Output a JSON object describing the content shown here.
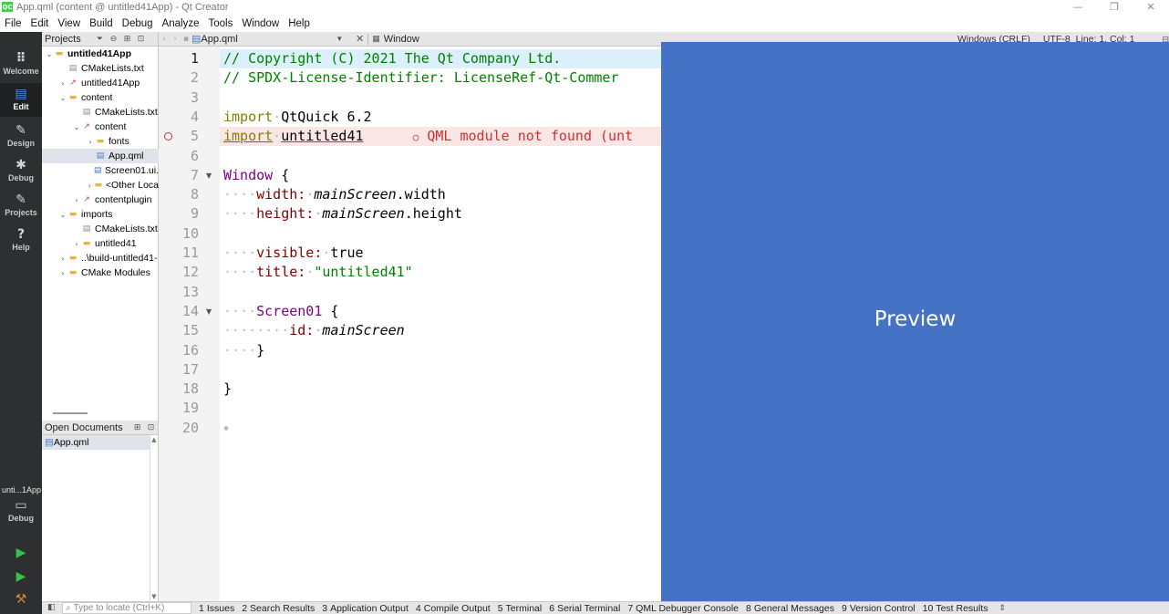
{
  "window": {
    "app_icon": "QC",
    "title": "App.qml (content @ untitled41App) - Qt Creator",
    "controls": [
      "—",
      "❐",
      "✕"
    ]
  },
  "menu": [
    "File",
    "Edit",
    "View",
    "Build",
    "Debug",
    "Analyze",
    "Tools",
    "Window",
    "Help"
  ],
  "modes": [
    {
      "label": "Welcome",
      "icon": "grid-icon",
      "glyph": "⠿"
    },
    {
      "label": "Edit",
      "icon": "edit-icon",
      "glyph": "▤",
      "active": true
    },
    {
      "label": "Design",
      "icon": "pen-icon",
      "glyph": "✎"
    },
    {
      "label": "Debug",
      "icon": "bug-icon",
      "glyph": "✱"
    },
    {
      "label": "Projects",
      "icon": "wrench-icon",
      "glyph": "✎"
    },
    {
      "label": "Help",
      "icon": "help-icon",
      "glyph": "?"
    }
  ],
  "kit": {
    "label": "unti...1App",
    "mode": "Debug",
    "glyph": "▭"
  },
  "projects": {
    "title": "Projects",
    "tree": [
      {
        "label": "untitled41App",
        "depth": 0,
        "arrow": "v",
        "icon": "folder",
        "bold": true
      },
      {
        "label": "CMakeLists.txt",
        "depth": 1,
        "arrow": "",
        "icon": "cmake"
      },
      {
        "label": "untitled41App",
        "depth": 1,
        "arrow": ">",
        "icon": "proj"
      },
      {
        "label": "content",
        "depth": 1,
        "arrow": "v",
        "icon": "folder"
      },
      {
        "label": "CMakeLists.txt",
        "depth": 2,
        "arrow": "",
        "icon": "cmake"
      },
      {
        "label": "content",
        "depth": 2,
        "arrow": "v",
        "icon": "proj"
      },
      {
        "label": "fonts",
        "depth": 3,
        "arrow": ">",
        "icon": "folder"
      },
      {
        "label": "App.qml",
        "depth": 3,
        "arrow": "",
        "icon": "qml",
        "selected": true
      },
      {
        "label": "Screen01.ui.",
        "depth": 3,
        "arrow": "",
        "icon": "qml"
      },
      {
        "label": "<Other Loca",
        "depth": 3,
        "arrow": ">",
        "icon": "folder"
      },
      {
        "label": "contentplugin",
        "depth": 2,
        "arrow": ">",
        "icon": "proj"
      },
      {
        "label": "imports",
        "depth": 1,
        "arrow": "v",
        "icon": "folder"
      },
      {
        "label": "CMakeLists.txt",
        "depth": 2,
        "arrow": "",
        "icon": "cmake"
      },
      {
        "label": "untitled41",
        "depth": 2,
        "arrow": ">",
        "icon": "folder"
      },
      {
        "label": "..\\build-untitled41-",
        "depth": 1,
        "arrow": ">",
        "icon": "folder"
      },
      {
        "label": "CMake Modules",
        "depth": 1,
        "arrow": ">",
        "icon": "folder"
      }
    ]
  },
  "open_documents": {
    "title": "Open Documents",
    "items": [
      "App.qml"
    ]
  },
  "editor_toolbar": {
    "file": "App.qml",
    "symbol": "Window",
    "line_endings": "Windows (CRLF)",
    "encoding": "UTF-8",
    "position": "Line: 1, Col: 1"
  },
  "editor": {
    "lines": [
      {
        "n": "1"
      },
      {
        "n": "2"
      },
      {
        "n": "3"
      },
      {
        "n": "4"
      },
      {
        "n": "5"
      },
      {
        "n": "6"
      },
      {
        "n": "7"
      },
      {
        "n": "8"
      },
      {
        "n": "9"
      },
      {
        "n": "10"
      },
      {
        "n": "11"
      },
      {
        "n": "12"
      },
      {
        "n": "13"
      },
      {
        "n": "14"
      },
      {
        "n": "15"
      },
      {
        "n": "16"
      },
      {
        "n": "17"
      },
      {
        "n": "18"
      },
      {
        "n": "19"
      },
      {
        "n": "20"
      }
    ],
    "code": {
      "l1": "// Copyright (C) 2021 The Qt Company Ltd.",
      "l2": "// SPDX-License-Identifier: LicenseRef-Qt-Commer",
      "l4_kw": "import",
      "l4_rest": "QtQuick 6.2",
      "l5_kw": "import",
      "l5_mod": "untitled41",
      "l5_err": "QML module not found (unt",
      "l7_type": "Window",
      "l7_rest": " {",
      "l8_prop": "width:",
      "l8_val": "mainScreen",
      "l8_rest": ".width",
      "l9_prop": "height:",
      "l9_val": "mainScreen",
      "l9_rest": ".height",
      "l11_prop": "visible:",
      "l11_val": "true",
      "l12_prop": "title:",
      "l12_val": "\"untitled41\"",
      "l14_type": "Screen01",
      "l14_rest": " {",
      "l15_prop": "id:",
      "l15_val": "mainScreen",
      "l16": "}",
      "l18": "}"
    }
  },
  "preview": {
    "label": "Preview"
  },
  "statusbar": {
    "locator_placeholder": "Type to locate (Ctrl+K)",
    "tabs": [
      {
        "num": "1",
        "label": "Issues"
      },
      {
        "num": "2",
        "label": "Search Results"
      },
      {
        "num": "3",
        "label": "Application Output"
      },
      {
        "num": "4",
        "label": "Compile Output"
      },
      {
        "num": "5",
        "label": "Terminal"
      },
      {
        "num": "6",
        "label": "Serial Terminal"
      },
      {
        "num": "7",
        "label": "QML Debugger Console"
      },
      {
        "num": "8",
        "label": "General Messages"
      },
      {
        "num": "9",
        "label": "Version Control"
      },
      {
        "num": "10",
        "label": "Test Results"
      }
    ]
  }
}
